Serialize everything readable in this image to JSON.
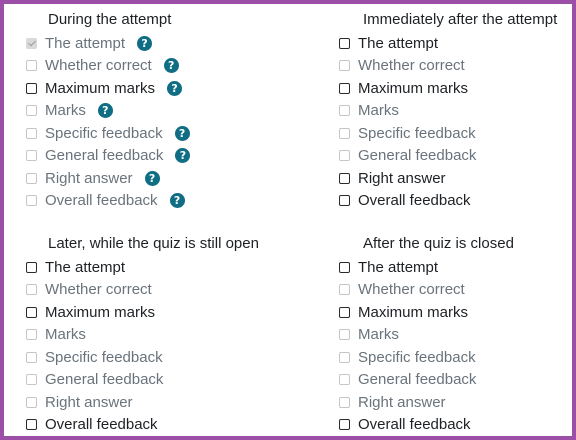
{
  "sections": [
    {
      "heading": "During the attempt",
      "items": [
        {
          "label": "The attempt",
          "checked": true,
          "disabled": true,
          "help": true
        },
        {
          "label": "Whether correct",
          "checked": false,
          "disabled": true,
          "help": true
        },
        {
          "label": "Maximum marks",
          "checked": false,
          "disabled": false,
          "help": true
        },
        {
          "label": "Marks",
          "checked": false,
          "disabled": true,
          "help": true
        },
        {
          "label": "Specific feedback",
          "checked": false,
          "disabled": true,
          "help": true
        },
        {
          "label": "General feedback",
          "checked": false,
          "disabled": true,
          "help": true
        },
        {
          "label": "Right answer",
          "checked": false,
          "disabled": true,
          "help": true
        },
        {
          "label": "Overall feedback",
          "checked": false,
          "disabled": true,
          "help": true
        }
      ]
    },
    {
      "heading": "Immediately after the attempt",
      "items": [
        {
          "label": "The attempt",
          "checked": false,
          "disabled": false
        },
        {
          "label": "Whether correct",
          "checked": false,
          "disabled": true
        },
        {
          "label": "Maximum marks",
          "checked": false,
          "disabled": false
        },
        {
          "label": "Marks",
          "checked": false,
          "disabled": true
        },
        {
          "label": "Specific feedback",
          "checked": false,
          "disabled": true
        },
        {
          "label": "General feedback",
          "checked": false,
          "disabled": true
        },
        {
          "label": "Right answer",
          "checked": false,
          "disabled": false
        },
        {
          "label": "Overall feedback",
          "checked": false,
          "disabled": false
        }
      ]
    },
    {
      "heading": "Later, while the quiz is still open",
      "items": [
        {
          "label": "The attempt",
          "checked": false,
          "disabled": false
        },
        {
          "label": "Whether correct",
          "checked": false,
          "disabled": true
        },
        {
          "label": "Maximum marks",
          "checked": false,
          "disabled": false
        },
        {
          "label": "Marks",
          "checked": false,
          "disabled": true
        },
        {
          "label": "Specific feedback",
          "checked": false,
          "disabled": true
        },
        {
          "label": "General feedback",
          "checked": false,
          "disabled": true
        },
        {
          "label": "Right answer",
          "checked": false,
          "disabled": true
        },
        {
          "label": "Overall feedback",
          "checked": false,
          "disabled": false
        }
      ]
    },
    {
      "heading": "After the quiz is closed",
      "items": [
        {
          "label": "The attempt",
          "checked": false,
          "disabled": false
        },
        {
          "label": "Whether correct",
          "checked": false,
          "disabled": true
        },
        {
          "label": "Maximum marks",
          "checked": false,
          "disabled": false
        },
        {
          "label": "Marks",
          "checked": false,
          "disabled": true
        },
        {
          "label": "Specific feedback",
          "checked": false,
          "disabled": true
        },
        {
          "label": "General feedback",
          "checked": false,
          "disabled": true
        },
        {
          "label": "Right answer",
          "checked": false,
          "disabled": true
        },
        {
          "label": "Overall feedback",
          "checked": false,
          "disabled": false
        }
      ]
    }
  ],
  "help_icon": {
    "name": "question-help-icon",
    "glyph": "?"
  },
  "colors": {
    "frame": "#9b4fa6",
    "help": "#0f6e84"
  }
}
